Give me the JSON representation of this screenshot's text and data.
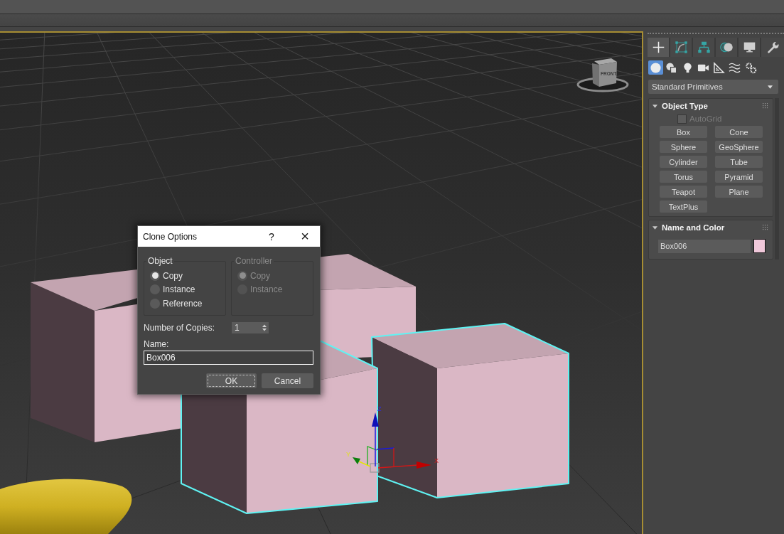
{
  "viewport": {
    "active": true,
    "viewcube": {
      "label": "FRONT"
    },
    "objects": [
      {
        "kind": "box",
        "selected": false
      },
      {
        "kind": "box",
        "selected": false
      },
      {
        "kind": "box",
        "selected": true
      },
      {
        "kind": "box",
        "selected": true
      },
      {
        "kind": "blob",
        "selected": false
      }
    ],
    "gizmo_axes": [
      {
        "label": "X"
      },
      {
        "label": "Y"
      },
      {
        "label": "Z"
      }
    ]
  },
  "dialog": {
    "title": "Clone Options",
    "help": "?",
    "close": "×",
    "groups": [
      {
        "title": "Object",
        "disabled": false,
        "options": [
          {
            "label": "Copy",
            "selected": true
          },
          {
            "label": "Instance",
            "selected": false
          },
          {
            "label": "Reference",
            "selected": false
          }
        ]
      },
      {
        "title": "Controller",
        "disabled": true,
        "options": [
          {
            "label": "Copy",
            "selected": true
          },
          {
            "label": "Instance",
            "selected": false
          }
        ]
      }
    ],
    "copies": {
      "label": "Number of Copies:",
      "value": "1"
    },
    "name": {
      "label": "Name:",
      "value": "Box006",
      "focused": true
    },
    "buttons": [
      {
        "label": "OK",
        "focused": true
      },
      {
        "label": "Cancel",
        "focused": false
      }
    ]
  },
  "command_panel": {
    "tabs": [
      {
        "kind": "create",
        "selected": true
      },
      {
        "kind": "modify",
        "selected": false
      },
      {
        "kind": "hierarchy",
        "selected": false
      },
      {
        "kind": "motion",
        "selected": false
      },
      {
        "kind": "display",
        "selected": false
      },
      {
        "kind": "utilities",
        "selected": false
      }
    ],
    "categories": [
      {
        "kind": "geometry",
        "selected": true
      },
      {
        "kind": "shapes",
        "selected": false
      },
      {
        "kind": "lights",
        "selected": false
      },
      {
        "kind": "cameras",
        "selected": false
      },
      {
        "kind": "helpers",
        "selected": false
      },
      {
        "kind": "spacewarps",
        "selected": false
      },
      {
        "kind": "systems",
        "selected": false
      }
    ],
    "dropdown": {
      "value": "Standard Primitives"
    },
    "object_type": {
      "title": "Object Type",
      "expanded": true,
      "autogrid": {
        "label": "AutoGrid",
        "checked": false,
        "disabled": true
      },
      "buttons": [
        "Box",
        "Cone",
        "Sphere",
        "GeoSphere",
        "Cylinder",
        "Tube",
        "Torus",
        "Pyramid",
        "Teapot",
        "Plane",
        "TextPlus"
      ]
    },
    "name_and_color": {
      "title": "Name and Color",
      "expanded": true,
      "name": {
        "value": "Box006"
      },
      "color": "#f0c8da"
    }
  }
}
